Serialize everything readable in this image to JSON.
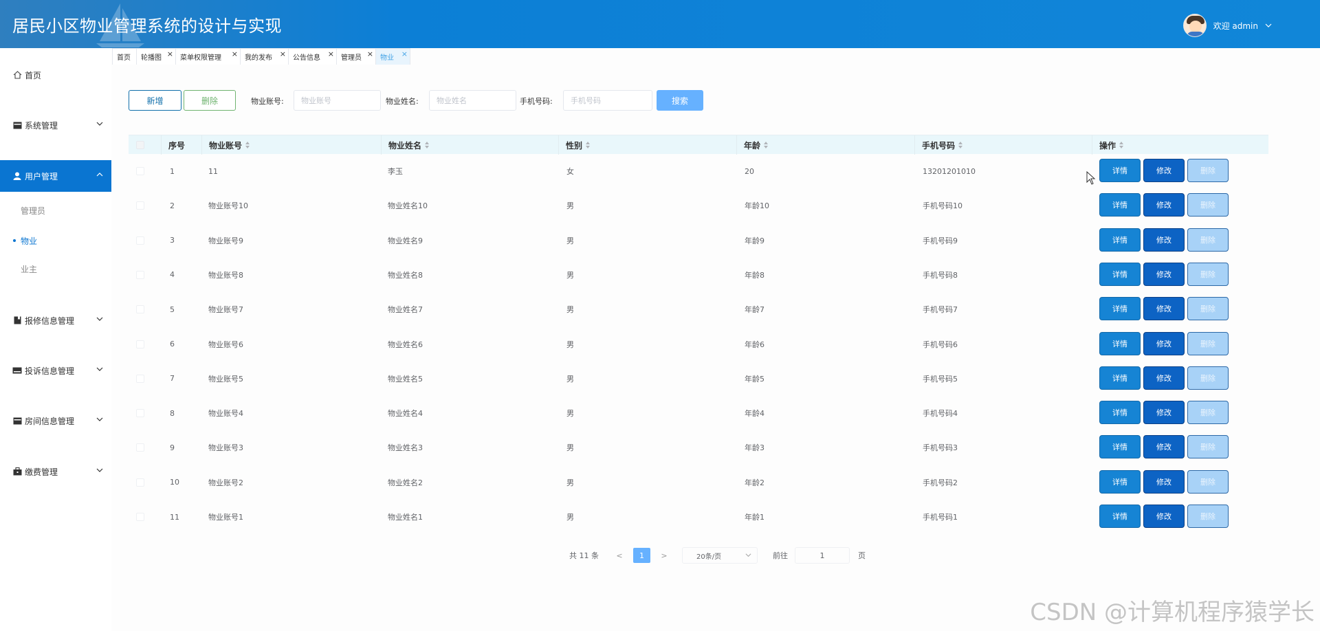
{
  "app": {
    "title": "居民小区物业管理系统的设计与实现",
    "user_greeting": "欢迎 admin"
  },
  "sidebar": {
    "items": [
      {
        "label": "首页",
        "icon": "home-icon"
      },
      {
        "label": "系统管理",
        "icon": "card-icon"
      },
      {
        "label": "用户管理",
        "icon": "user-icon"
      },
      {
        "label": "报修信息管理",
        "icon": "bookmark-icon"
      },
      {
        "label": "投诉信息管理",
        "icon": "keyboard-icon"
      },
      {
        "label": "房间信息管理",
        "icon": "card-icon"
      },
      {
        "label": "缴费管理",
        "icon": "briefcase-icon"
      }
    ],
    "user_sub": [
      "管理员",
      "物业",
      "业主"
    ]
  },
  "tabs": [
    {
      "label": "首页"
    },
    {
      "label": "轮播图"
    },
    {
      "label": "菜单权限管理"
    },
    {
      "label": "我的发布"
    },
    {
      "label": "公告信息"
    },
    {
      "label": "管理员"
    },
    {
      "label": "物业"
    }
  ],
  "toolbar": {
    "add_label": "新增",
    "delete_label": "删除",
    "account_label": "物业账号:",
    "account_placeholder": "物业账号",
    "name_label": "物业姓名:",
    "name_placeholder": "物业姓名",
    "phone_label": "手机号码:",
    "phone_placeholder": "手机号码",
    "search_label": "搜索"
  },
  "table": {
    "headers": [
      "序号",
      "物业账号",
      "物业姓名",
      "性别",
      "年龄",
      "手机号码",
      "操作"
    ],
    "action_labels": {
      "detail": "详情",
      "edit": "修改",
      "delete": "删除"
    },
    "rows": [
      [
        "1",
        "11",
        "李玉",
        "女",
        "20",
        "13201201010"
      ],
      [
        "2",
        "物业账号10",
        "物业姓名10",
        "男",
        "年龄10",
        "手机号码10"
      ],
      [
        "3",
        "物业账号9",
        "物业姓名9",
        "男",
        "年龄9",
        "手机号码9"
      ],
      [
        "4",
        "物业账号8",
        "物业姓名8",
        "男",
        "年龄8",
        "手机号码8"
      ],
      [
        "5",
        "物业账号7",
        "物业姓名7",
        "男",
        "年龄7",
        "手机号码7"
      ],
      [
        "6",
        "物业账号6",
        "物业姓名6",
        "男",
        "年龄6",
        "手机号码6"
      ],
      [
        "7",
        "物业账号5",
        "物业姓名5",
        "男",
        "年龄5",
        "手机号码5"
      ],
      [
        "8",
        "物业账号4",
        "物业姓名4",
        "男",
        "年龄4",
        "手机号码4"
      ],
      [
        "9",
        "物业账号3",
        "物业姓名3",
        "男",
        "年龄3",
        "手机号码3"
      ],
      [
        "10",
        "物业账号2",
        "物业姓名2",
        "男",
        "年龄2",
        "手机号码2"
      ],
      [
        "11",
        "物业账号1",
        "物业姓名1",
        "男",
        "年龄1",
        "手机号码1"
      ]
    ]
  },
  "pagination": {
    "total": "共 11 条",
    "prev": "<",
    "current": "1",
    "next": ">",
    "page_size": "20条/页",
    "goto_label": "前往",
    "goto_value": "1",
    "page_suffix": "页"
  },
  "watermark": "CSDN @计算机程序猿学长",
  "colors": {
    "header": "#0c7fd6",
    "active_menu": "#0a75d1",
    "search_button": "#66b1ff",
    "detail_button": "#1684d4",
    "edit_button": "#0d63c4",
    "delete_button": "#a8d2f7"
  }
}
